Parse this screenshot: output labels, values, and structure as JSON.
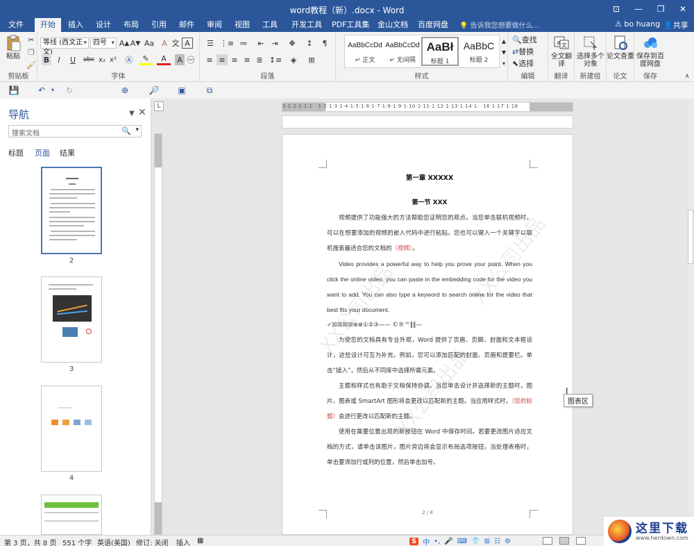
{
  "window": {
    "title": "word教程（新）.docx - Word",
    "controls": [
      "⊡",
      "—",
      "❐",
      "✕"
    ]
  },
  "tabs": [
    "文件",
    "开始",
    "插入",
    "设计",
    "布局",
    "引用",
    "邮件",
    "审阅",
    "视图",
    "工具",
    "开发工具",
    "PDF工具集",
    "金山文档",
    "百度网盘"
  ],
  "tellme": "告诉我您想要做什么...",
  "user": "bo huang",
  "share": "共享",
  "ribbon": {
    "clipboard": {
      "paste": "粘贴",
      "label": "剪贴板"
    },
    "font": {
      "name": "等线 (西文正文)",
      "size": "四号",
      "label": "字体",
      "buttons": [
        "B",
        "I",
        "U",
        "abc",
        "x₂",
        "x²",
        "A",
        "A",
        "Aa"
      ]
    },
    "paragraph": {
      "label": "段落"
    },
    "styles": {
      "label": "样式",
      "items": [
        {
          "sample": "AaBbCcDd",
          "name": "↵ 正文"
        },
        {
          "sample": "AaBbCcDd",
          "name": "↵ 无间隔"
        },
        {
          "sample": "AaBł",
          "name": "标题 1"
        },
        {
          "sample": "AaBbC",
          "name": "标题 2"
        }
      ]
    },
    "editing": {
      "find": "查找",
      "replace": "替换",
      "select": "选择",
      "label": "编辑"
    },
    "translate": {
      "btn": "全文翻译",
      "label": "翻译"
    },
    "newgroup": {
      "btn": "选择多个对象",
      "label": "新建组"
    },
    "paper": {
      "btn": "论文查重",
      "label": "论文"
    },
    "save": {
      "btn": "保存到百度网盘",
      "label": "保存"
    }
  },
  "nav": {
    "title": "导航",
    "search_placeholder": "搜索文档",
    "tabs": [
      "标题",
      "页面",
      "结果"
    ],
    "pages": [
      "2",
      "3",
      "4"
    ]
  },
  "ruler": {
    "corner": "L",
    "numbers": "3·1·2·1·1·1·  ·1·2·1·3·1·4·1·5·1·6·1·7·1·8·1·9·1·10·1·11·1·12·1·13·1·14·1·  ·16·1·17·1·18"
  },
  "document": {
    "chapter": "第一章  XXXXX",
    "section": "第一节  XXX",
    "p1": "视频提供了功能强大的方法帮助您证明您的观点。当您单击联机视频时，可以在想要添加的视频的嵌入代码中进行粘贴。您也可以键入一个关键字以联机搜索最适合您的文档的",
    "p1_red": "（视频）",
    "p1_end": "。",
    "p2": "Video provides a powerful way to help you prove your point. When you click the online video, you can paste in the embedding code for the video you want to add. You can also type a keyword to search online for the video that best fits your document.",
    "symbols": "✓☒☒☒☒⊗⊗①②③——      ©®™‖‖—",
    "p3": "为使您的文档具有专业外观，Word 提供了页眉、页脚、封面和文本框设计，这些设计可互为补充。例如，您可以添加匹配的封面、页眉和提要栏。单击“插入”，然后从不同库中选择所需元素。",
    "p4a": "主题和样式也有助于文档保持协调。当您单击设计并选择新的主题时，图片、图表或 SmartArt 图形将会更改以匹配新的主题。当应用样式时，",
    "p4_red": "（您的标题）",
    "p4b": "会进行更改以匹配新的主题。",
    "p5": "使用在需要位置出现的新按钮在 Word 中保存时间。若要更改图片适应文档的方式，请单击该图片，图片旁边将会显示布局选项按钮。当处理表格时，单击要添加行或列的位置，然后单击加号。",
    "page_num": "2 / 8",
    "watermark": "XX公司出品"
  },
  "tooltip": "图表区",
  "status": {
    "page": "第 3 页，共 8 页",
    "words": "551 个字",
    "lang": "英语(美国)",
    "revision": "修订: 关闭",
    "insert": "插入"
  },
  "ime": [
    "S",
    "中",
    "•,",
    "🎤",
    "⌨",
    "👕",
    "⊞",
    "☷",
    "⚙"
  ],
  "brand": {
    "name": "这里下载",
    "url": "www.herdown.com"
  }
}
